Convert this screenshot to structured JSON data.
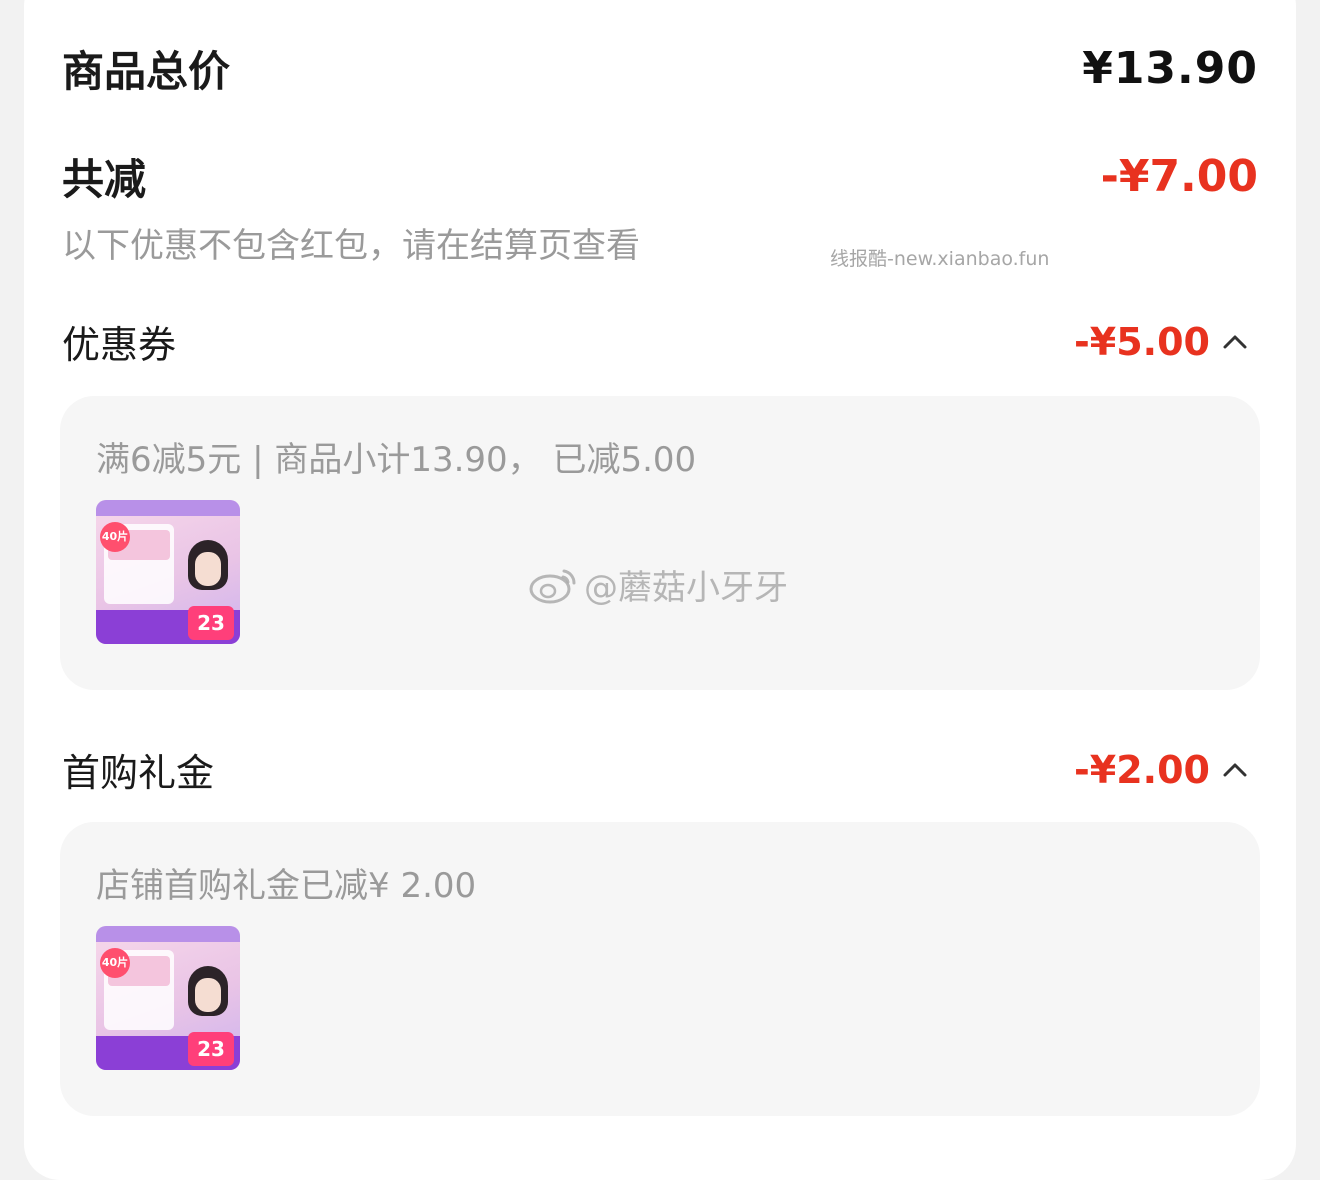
{
  "summary": {
    "total_label": "商品总价",
    "total_value": "¥13.90",
    "reduce_label": "共减",
    "reduce_value": "-¥7.00",
    "note": "以下优惠不包含红包，请在结算页查看"
  },
  "watermarks": {
    "site": "线报酷-new.xianbao.fun",
    "weibo": "@蘑菇小牙牙"
  },
  "coupon": {
    "label": "优惠券",
    "value": "-¥5.00",
    "detail": "满6减5元 | 商品小计13.90， 已减5.00",
    "thumb_count": "40片",
    "thumb_price": "23"
  },
  "gift": {
    "label": "首购礼金",
    "value": "-¥2.00",
    "detail": "店铺首购礼金已减¥ 2.00",
    "thumb_count": "40片",
    "thumb_price": "23"
  },
  "colors": {
    "accent_red": "#e8321f",
    "muted_text": "#9a9a9a",
    "panel_bg": "#f6f6f6"
  }
}
